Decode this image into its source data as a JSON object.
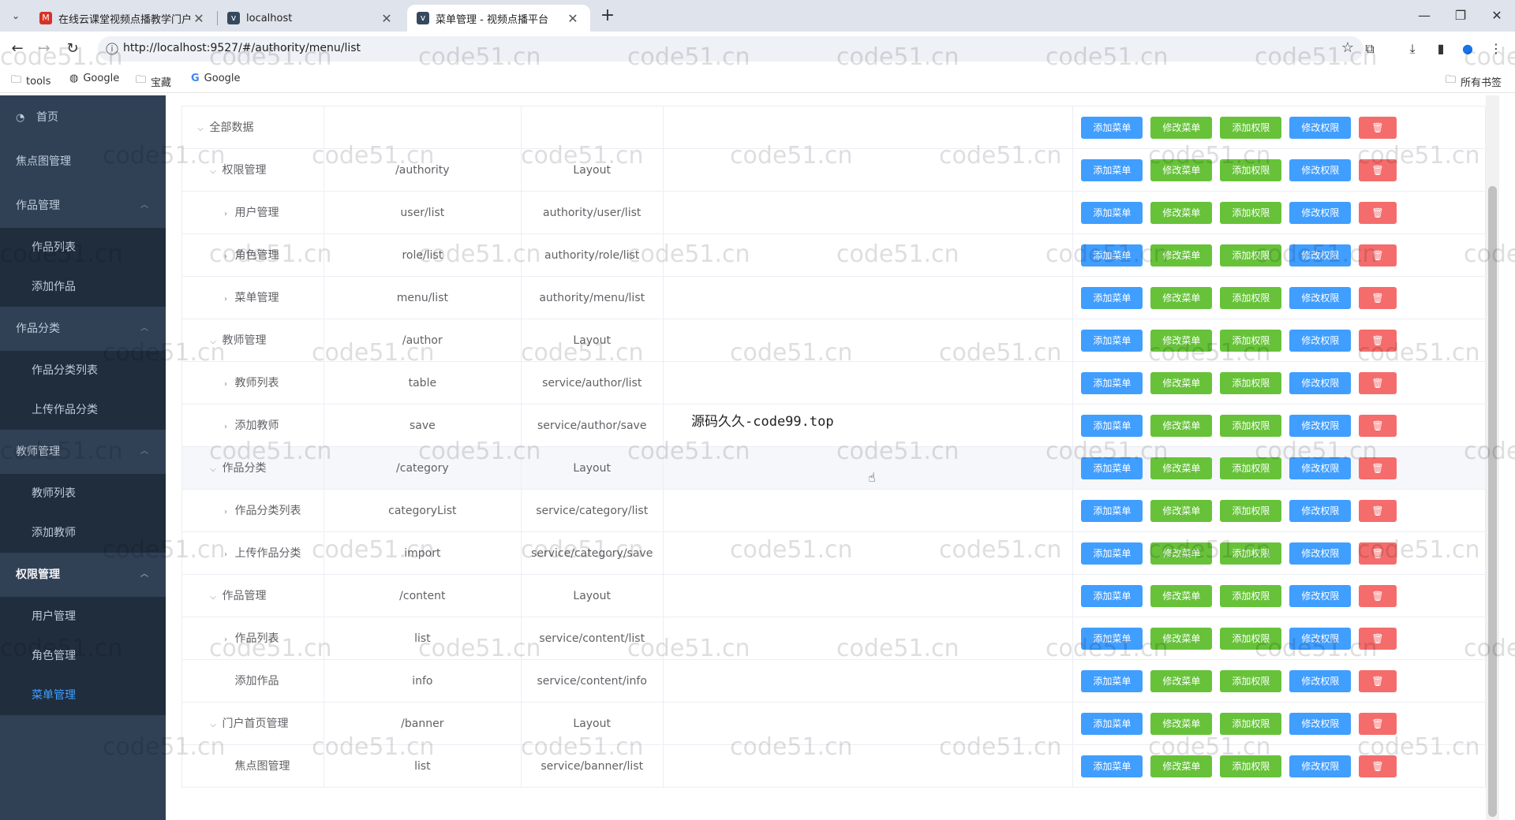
{
  "browser": {
    "tabs": [
      {
        "title": "在线云课堂视频点播教学门户系统",
        "active": false,
        "favicon": "M"
      },
      {
        "title": "localhost",
        "active": false,
        "favicon": "v"
      },
      {
        "title": "菜单管理 - 视频点播平台",
        "active": true,
        "favicon": "v"
      }
    ],
    "url": "http://localhost:9527/#/authority/menu/list",
    "bookmarks": [
      {
        "label": "tools",
        "icon": "folder-icon"
      },
      {
        "label": "Google",
        "icon": "globe-icon"
      },
      {
        "label": "宝藏",
        "icon": "folder-icon"
      },
      {
        "label": "Google",
        "icon": "google-icon"
      }
    ],
    "all_bookmarks": "所有书签"
  },
  "sidebar": {
    "home": "首页",
    "banner": "焦点图管理",
    "content": {
      "label": "作品管理",
      "items": [
        "作品列表",
        "添加作品"
      ]
    },
    "category": {
      "label": "作品分类",
      "items": [
        "作品分类列表",
        "上传作品分类"
      ]
    },
    "teacher": {
      "label": "教师管理",
      "items": [
        "教师列表",
        "添加教师"
      ]
    },
    "authority": {
      "label": "权限管理",
      "items": [
        "用户管理",
        "角色管理",
        "菜单管理"
      ]
    },
    "active_item": "菜单管理"
  },
  "table": {
    "buttons": {
      "add_menu": "添加菜单",
      "edit_menu": "修改菜单",
      "add_perm": "添加权限",
      "edit_perm": "修改权限"
    },
    "rows": [
      {
        "name": "全部数据",
        "path": "",
        "component": "",
        "level": 0,
        "expander": "open"
      },
      {
        "name": "权限管理",
        "path": "/authority",
        "component": "Layout",
        "level": 1,
        "expander": "open"
      },
      {
        "name": "用户管理",
        "path": "user/list",
        "component": "authority/user/list",
        "level": 2,
        "expander": "closed"
      },
      {
        "name": "角色管理",
        "path": "role/list",
        "component": "authority/role/list",
        "level": 2,
        "expander": "closed"
      },
      {
        "name": "菜单管理",
        "path": "menu/list",
        "component": "authority/menu/list",
        "level": 2,
        "expander": "closed"
      },
      {
        "name": "教师管理",
        "path": "/author",
        "component": "Layout",
        "level": 1,
        "expander": "open"
      },
      {
        "name": "教师列表",
        "path": "table",
        "component": "service/author/list",
        "level": 2,
        "expander": "closed"
      },
      {
        "name": "添加教师",
        "path": "save",
        "component": "service/author/save",
        "level": 2,
        "expander": "closed"
      },
      {
        "name": "作品分类",
        "path": "/category",
        "component": "Layout",
        "level": 1,
        "expander": "open"
      },
      {
        "name": "作品分类列表",
        "path": "categoryList",
        "component": "service/category/list",
        "level": 2,
        "expander": "closed"
      },
      {
        "name": "上传作品分类",
        "path": "import",
        "component": "service/category/save",
        "level": 2,
        "expander": "closed"
      },
      {
        "name": "作品管理",
        "path": "/content",
        "component": "Layout",
        "level": 1,
        "expander": "open"
      },
      {
        "name": "作品列表",
        "path": "list",
        "component": "service/content/list",
        "level": 2,
        "expander": "closed"
      },
      {
        "name": "添加作品",
        "path": "info",
        "component": "service/content/info",
        "level": 2,
        "expander": "none"
      },
      {
        "name": "门户首页管理",
        "path": "/banner",
        "component": "Layout",
        "level": 1,
        "expander": "open"
      },
      {
        "name": "焦点图管理",
        "path": "list",
        "component": "service/banner/list",
        "level": 2,
        "expander": "none"
      }
    ]
  },
  "overlay_note": "源码久久-code99.top",
  "watermark": "code51.cn",
  "colors": {
    "primary": "#409eff",
    "success": "#67c23a",
    "danger": "#f56c6c",
    "sidebar": "#304156"
  }
}
